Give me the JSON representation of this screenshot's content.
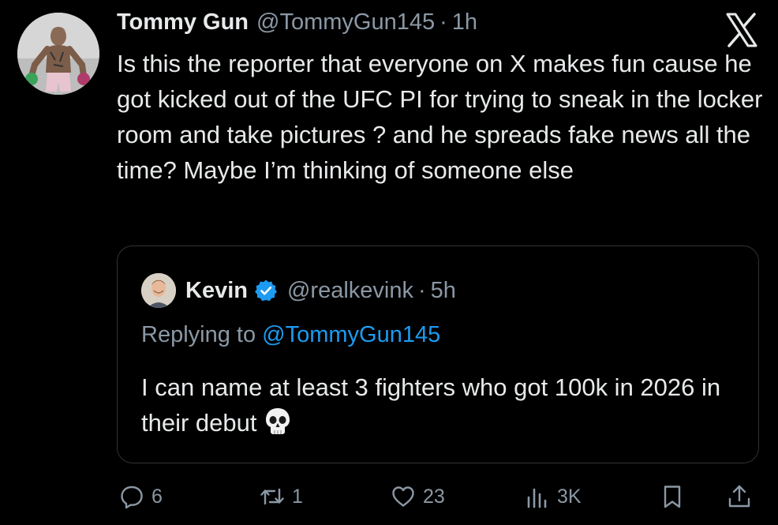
{
  "tweet": {
    "author": {
      "display_name": "Tommy Gun",
      "handle": "@TommyGun145",
      "separator": "·",
      "time": "1h"
    },
    "text": "Is this the reporter that everyone on X makes fun cause he got kicked out of the UFC PI for trying to sneak in the locker room and take pictures ? and he spreads fake news all the time? Maybe I’m thinking of someone else"
  },
  "quoted": {
    "author": {
      "display_name": "Kevin",
      "handle": "@realkevink",
      "separator": "·",
      "time": "5h",
      "verified": true
    },
    "replying_prefix": "Replying to ",
    "replying_to": "@TommyGun145",
    "text": "I can name at least 3 fighters who got 100k in 2026 in their debut",
    "emoji": "skull-emoji"
  },
  "actions": {
    "replies": "6",
    "reposts": "1",
    "likes": "23",
    "views": "3K"
  },
  "icons": {
    "brand": "x-logo-icon",
    "verified": "verified-badge-icon",
    "reply": "reply-icon",
    "repost": "repost-icon",
    "like": "heart-icon",
    "views": "views-bar-chart-icon",
    "bookmark": "bookmark-icon",
    "share": "share-icon"
  },
  "colors": {
    "background": "#000000",
    "text": "#e7e9ea",
    "muted": "#8b98a5",
    "accent": "#1d9bf0",
    "border": "#2f3336"
  }
}
